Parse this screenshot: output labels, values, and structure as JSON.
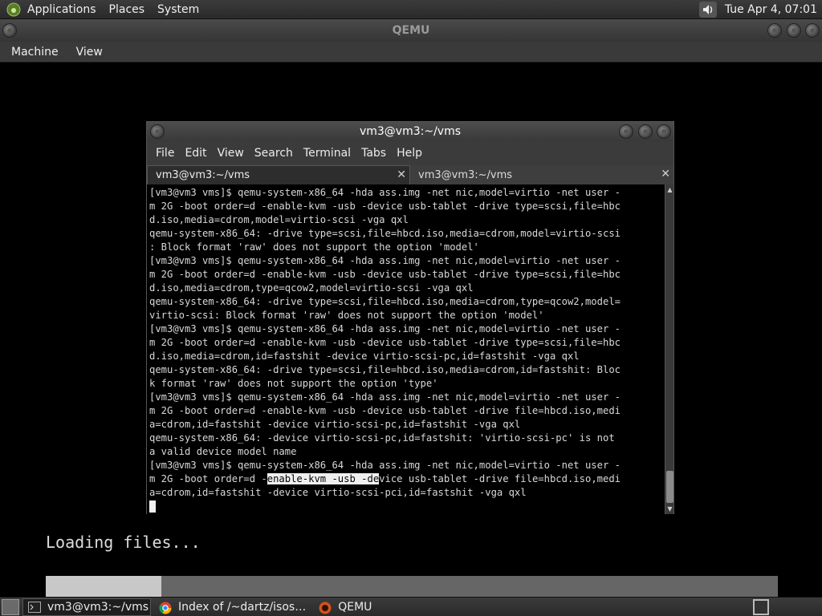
{
  "top_panel": {
    "menus": [
      "Applications",
      "Places",
      "System"
    ],
    "clock": "Tue Apr  4, 07:01",
    "icons": {
      "logo": "gnome-foot-icon",
      "volume": "volume-icon"
    }
  },
  "qemu": {
    "title": "QEMU",
    "menus": [
      "Machine",
      "View"
    ]
  },
  "terminal": {
    "title": "vm3@vm3:~/vms",
    "menus": [
      "File",
      "Edit",
      "View",
      "Search",
      "Terminal",
      "Tabs",
      "Help"
    ],
    "tabs": [
      {
        "label": "vm3@vm3:~/vms",
        "active": true
      },
      {
        "label": "vm3@vm3:~/vms",
        "active": false
      }
    ],
    "lines": [
      "[vm3@vm3 vms]$ qemu-system-x86_64 -hda ass.img -net nic,model=virtio -net user -",
      "m 2G -boot order=d -enable-kvm -usb -device usb-tablet -drive type=scsi,file=hbc",
      "d.iso,media=cdrom,model=virtio-scsi -vga qxl",
      "qemu-system-x86_64: -drive type=scsi,file=hbcd.iso,media=cdrom,model=virtio-scsi",
      ": Block format 'raw' does not support the option 'model'",
      "[vm3@vm3 vms]$ qemu-system-x86_64 -hda ass.img -net nic,model=virtio -net user -",
      "m 2G -boot order=d -enable-kvm -usb -device usb-tablet -drive type=scsi,file=hbc",
      "d.iso,media=cdrom,type=qcow2,model=virtio-scsi -vga qxl",
      "qemu-system-x86_64: -drive type=scsi,file=hbcd.iso,media=cdrom,type=qcow2,model=",
      "virtio-scsi: Block format 'raw' does not support the option 'model'",
      "[vm3@vm3 vms]$ qemu-system-x86_64 -hda ass.img -net nic,model=virtio -net user -",
      "m 2G -boot order=d -enable-kvm -usb -device usb-tablet -drive type=scsi,file=hbc",
      "d.iso,media=cdrom,id=fastshit -device virtio-scsi-pc,id=fastshit -vga qxl",
      "qemu-system-x86_64: -drive type=scsi,file=hbcd.iso,media=cdrom,id=fastshit: Bloc",
      "k format 'raw' does not support the option 'type'",
      "[vm3@vm3 vms]$ qemu-system-x86_64 -hda ass.img -net nic,model=virtio -net user -",
      "m 2G -boot order=d -enable-kvm -usb -device usb-tablet -drive file=hbcd.iso,medi",
      "a=cdrom,id=fastshit -device virtio-scsi-pc,id=fastshit -vga qxl",
      "qemu-system-x86_64: -device virtio-scsi-pc,id=fastshit: 'virtio-scsi-pc' is not",
      "a valid device model name",
      "[vm3@vm3 vms]$ qemu-system-x86_64 -hda ass.img -net nic,model=virtio -net user -"
    ],
    "sel_line": {
      "before": "m 2G -boot order=d -",
      "selected": "enable-kvm -usb -de",
      "after": "vice usb-tablet -drive file=hbcd.iso,medi"
    },
    "last_line": "a=cdrom,id=fastshit -device virtio-scsi-pci,id=fastshit -vga qxl"
  },
  "guest": {
    "loading_text": "Loading files...",
    "progress": 0.158
  },
  "taskbar": {
    "tasks": [
      {
        "label": "vm3@vm3:~/vms",
        "icon": "terminal-icon",
        "active": true
      },
      {
        "label": "Index of /~dartz/isos…",
        "icon": "chrome-icon",
        "active": false
      },
      {
        "label": "QEMU",
        "icon": "qemu-icon",
        "active": false
      }
    ]
  },
  "colors": {
    "panel": "#2f2f2f",
    "selection": "#f0f0f0",
    "progress_fill": "#c8c8c8",
    "progress_track": "#666666"
  }
}
